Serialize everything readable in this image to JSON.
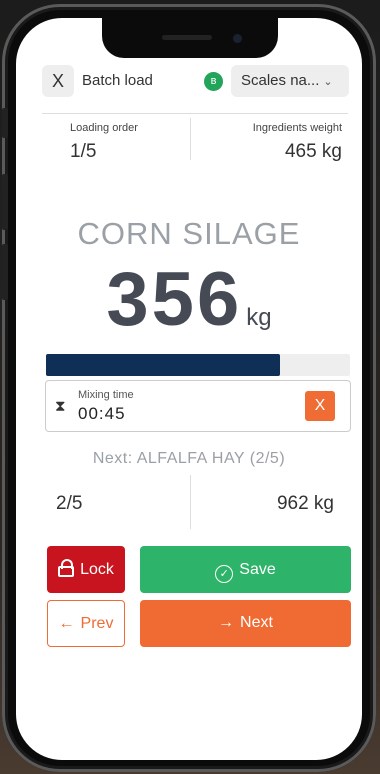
{
  "header": {
    "close_label": "X",
    "title": "Batch load",
    "bluetooth_icon": "bluetooth-icon",
    "scales_dropdown": "Scales na..."
  },
  "stats": {
    "loading_order_label": "Loading order",
    "loading_order_value": "1/5",
    "ingredients_weight_label": "Ingredients weight",
    "ingredients_weight_value": "465 kg"
  },
  "current": {
    "product": "CORN SILAGE",
    "weight": "356",
    "unit": "kg",
    "progress_percent": 77
  },
  "mixing": {
    "label": "Mixing time",
    "value": "00:45",
    "clear_label": "X"
  },
  "next_ingredient": {
    "label": "Next: ALFALFA HAY (2/5)",
    "order": "2/5",
    "weight": "962 kg"
  },
  "actions": {
    "lock_label": "Lock",
    "save_label": "Save",
    "prev_label": "Prev",
    "next_label": "Next"
  },
  "colors": {
    "progress": "#0f2f57",
    "lock": "#c8141e",
    "save": "#2eb36a",
    "next": "#f06a33",
    "bluetooth": "#22a55a"
  }
}
